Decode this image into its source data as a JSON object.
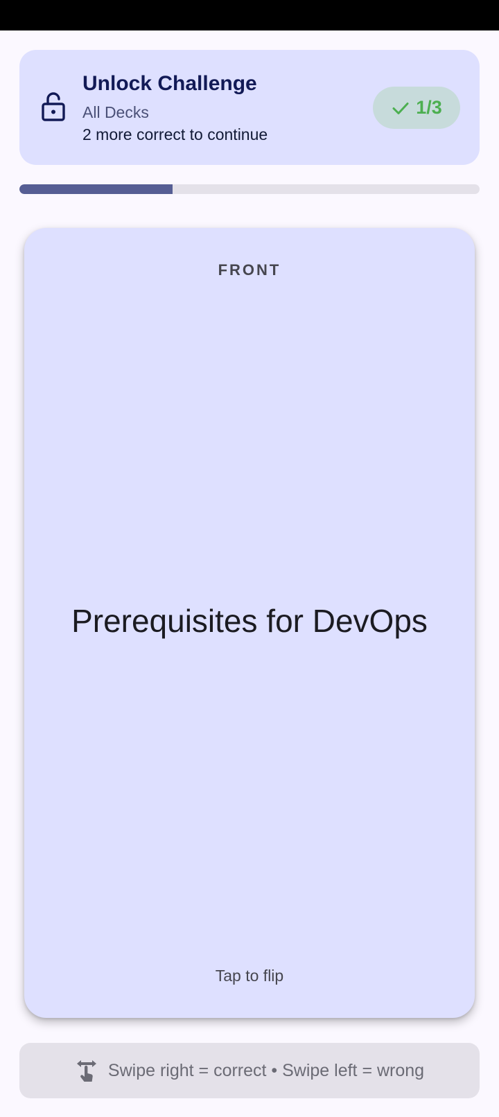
{
  "header": {
    "title": "Unlock Challenge",
    "deck": "All Decks",
    "status": "2 more correct to continue",
    "score": "1/3"
  },
  "progress": {
    "fraction": 0.333
  },
  "card": {
    "side_label": "FRONT",
    "question": "Prerequisites for DevOps",
    "hint": "Tap to flip"
  },
  "footer": {
    "instruction": "Swipe right = correct • Swipe left = wrong"
  },
  "icons": {
    "lock": "lock-open-icon",
    "check": "check-icon",
    "swipe": "swipe-gesture-icon"
  },
  "colors": {
    "accent": "#565e94",
    "card_background": "#dee0ff",
    "success": "#4caf50",
    "title": "#121a56"
  }
}
